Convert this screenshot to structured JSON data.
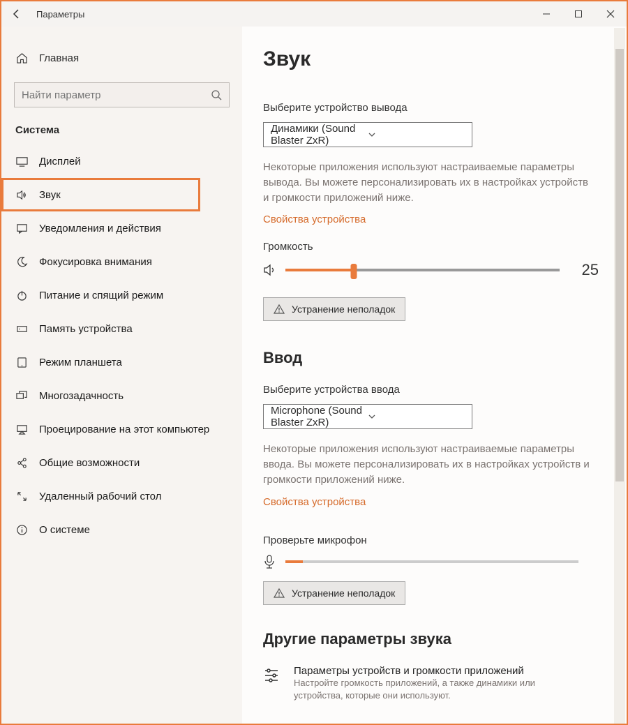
{
  "window": {
    "title": "Параметры"
  },
  "sidebar": {
    "home": "Главная",
    "search_placeholder": "Найти параметр",
    "category": "Система",
    "items": [
      {
        "label": "Дисплей"
      },
      {
        "label": "Звук",
        "active": true
      },
      {
        "label": "Уведомления и действия"
      },
      {
        "label": "Фокусировка внимания"
      },
      {
        "label": "Питание и спящий режим"
      },
      {
        "label": "Память устройства"
      },
      {
        "label": "Режим планшета"
      },
      {
        "label": "Многозадачность"
      },
      {
        "label": "Проецирование на этот компьютер"
      },
      {
        "label": "Общие возможности"
      },
      {
        "label": "Удаленный рабочий стол"
      },
      {
        "label": "О системе"
      }
    ]
  },
  "main": {
    "title": "Звук",
    "output": {
      "choose_label": "Выберите устройство вывода",
      "device": "Динамики (Sound Blaster ZxR)",
      "desc": "Некоторые приложения используют настраиваемые параметры вывода. Вы можете персонализировать их в настройках устройств и громкости приложений ниже.",
      "props_link": "Свойства устройства",
      "volume_label": "Громкость",
      "volume_value": "25",
      "volume_percent": 25,
      "troubleshoot": "Устранение неполадок"
    },
    "input": {
      "heading": "Ввод",
      "choose_label": "Выберите устройства ввода",
      "device": "Microphone (Sound Blaster ZxR)",
      "desc": "Некоторые приложения используют настраиваемые параметры ввода. Вы можете персонализировать их в настройках устройств и громкости приложений ниже.",
      "props_link": "Свойства устройства",
      "check_label": "Проверьте микрофон",
      "mic_level_percent": 6,
      "troubleshoot": "Устранение неполадок"
    },
    "other": {
      "heading": "Другие параметры звука",
      "item_title": "Параметры устройств и громкости приложений",
      "item_desc": "Настройте громкость приложений, а также динамики или устройства, которые они используют."
    }
  }
}
